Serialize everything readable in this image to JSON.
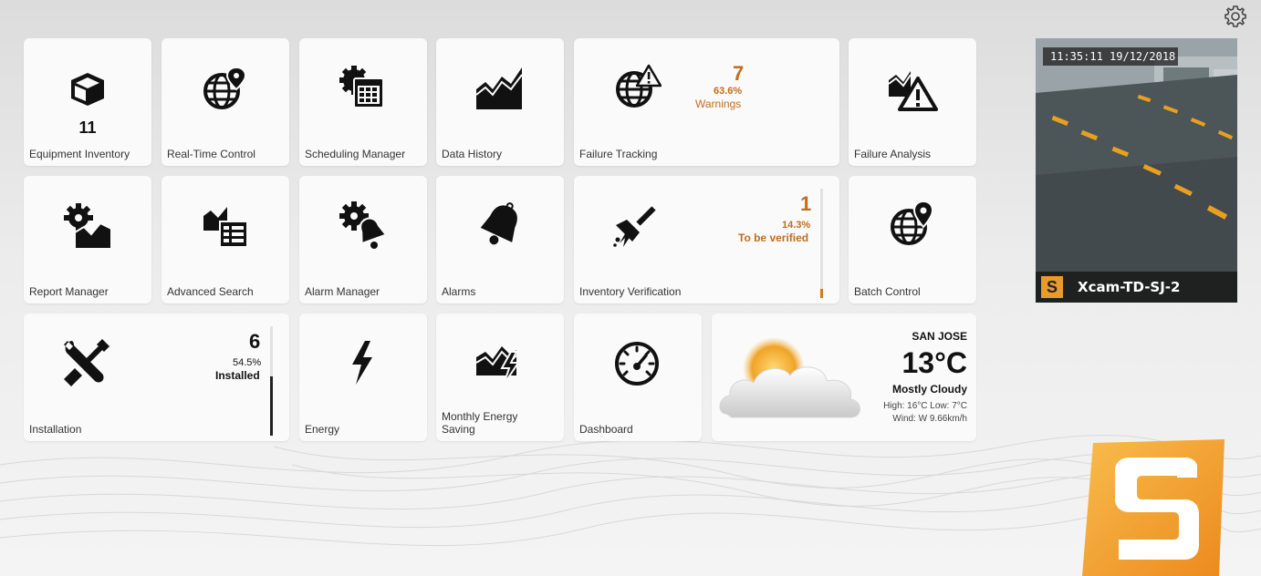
{
  "tiles": {
    "equipment_inventory": {
      "label": "Equipment Inventory",
      "count": "11"
    },
    "real_time_control": {
      "label": "Real-Time Control"
    },
    "scheduling_manager": {
      "label": "Scheduling Manager"
    },
    "data_history": {
      "label": "Data History"
    },
    "failure_tracking": {
      "label": "Failure Tracking",
      "count": "7",
      "percent": "63.6%",
      "sub": "Warnings"
    },
    "failure_analysis": {
      "label": "Failure Analysis"
    },
    "report_manager": {
      "label": "Report Manager"
    },
    "advanced_search": {
      "label": "Advanced Search"
    },
    "alarm_manager": {
      "label": "Alarm Manager"
    },
    "alarms": {
      "label": "Alarms"
    },
    "inventory_verification": {
      "label": "Inventory Verification",
      "count": "1",
      "percent": "14.3%",
      "sub": "To be verified",
      "progress": 0.143
    },
    "batch_control": {
      "label": "Batch Control"
    },
    "installation": {
      "label": "Installation",
      "count": "6",
      "percent": "54.5%",
      "sub": "Installed",
      "progress": 0.545
    },
    "energy": {
      "label": "Energy"
    },
    "monthly_energy_saving": {
      "label_line1": "Monthly Energy",
      "label_line2": "Saving"
    },
    "dashboard": {
      "label": "Dashboard"
    }
  },
  "weather": {
    "city": "SAN JOSE",
    "temperature": "13°C",
    "condition": "Mostly Cloudy",
    "high_low": "High: 16°C Low: 7°C",
    "wind": "Wind: W 9.66km/h"
  },
  "camera": {
    "timestamp": "11:35:11 19/12/2018",
    "badge": "S",
    "name": "Xcam-TD-SJ-2"
  },
  "icons": {
    "settings": "gear-icon",
    "logo": "s-logo"
  },
  "colors": {
    "accent_orange": "#c26c1c",
    "logo_orange": "#f0a030",
    "progress_orange": "#d07a1c",
    "progress_dark": "#222222"
  }
}
